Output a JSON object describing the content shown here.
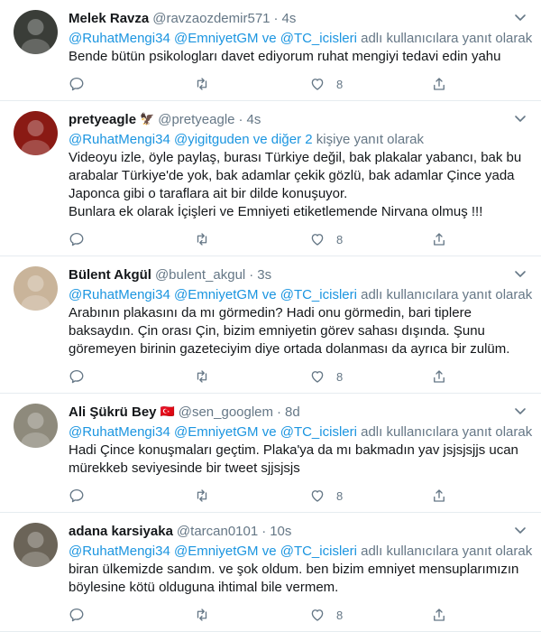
{
  "tweets": [
    {
      "name": "Melek Ravza",
      "badge": "",
      "handle": "@ravzaozdemir571",
      "dot": "·",
      "time": "4s",
      "reply_prefix": "",
      "reply_mentions": "@RuhatMengi34 @EmniyetGM ve @TC_icisleri",
      "reply_suffix": " adlı kullanıcılara yanıt olarak",
      "lines": [
        "Bende bütün psikologları davet ediyorum ruhat mengiyi tedavi edin yahu"
      ],
      "likes": "8",
      "avatar_color": "#3a3d38"
    },
    {
      "name": "pretyeagle",
      "badge": "🦅",
      "handle": "@pretyeagle",
      "dot": "·",
      "time": "4s",
      "reply_mentions": "@RuhatMengi34 @yigitguden ve diğer 2",
      "reply_suffix": " kişiye yanıt olarak",
      "lines": [
        "Videoyu izle, öyle paylaş, burası Türkiye değil, bak plakalar yabancı, bak bu",
        "arabalar Türkiye'de yok, bak adamlar çekik gözlü, bak adamlar Çince yada",
        "Japonca gibi o taraflara ait bir dilde konuşuyor.",
        "Bunlara ek olarak İçişleri ve Emniyeti etiketlemende Nirvana olmuş !!!"
      ],
      "likes": "8",
      "avatar_color": "#8a1a14"
    },
    {
      "name": "Bülent Akgül",
      "badge": "",
      "handle": "@bulent_akgul",
      "dot": "·",
      "time": "3s",
      "reply_mentions": "@RuhatMengi34 @EmniyetGM ve @TC_icisleri",
      "reply_suffix": " adlı kullanıcılara yanıt olarak",
      "lines": [
        "Arabının plakasını da mı görmedin? Hadi onu görmedin, bari tiplere",
        "baksaydın. Çin orası Çin, bizim emniyetin görev sahası dışında. Şunu",
        "göremeyen birinin gazeteciyim diye ortada dolanması da ayrıca bir zulüm."
      ],
      "likes": "8",
      "avatar_color": "#c9b49a"
    },
    {
      "name": "Ali Şükrü Bey",
      "badge": "🇹🇷",
      "handle": "@sen_googlem",
      "dot": "·",
      "time": "8d",
      "reply_mentions": "@RuhatMengi34 @EmniyetGM ve @TC_icisleri",
      "reply_suffix": " adlı kullanıcılara yanıt olarak",
      "lines": [
        "Hadi Çince konuşmaları geçtim. Plaka'ya da mı bakmadın yav jsjsjsjjs ucan",
        "mürekkeb seviyesinde bir tweet sjjsjsjs"
      ],
      "likes": "8",
      "avatar_color": "#8e8a7c"
    },
    {
      "name": "adana karsiyaka",
      "badge": "",
      "handle": "@tarcan0101",
      "dot": "·",
      "time": "10s",
      "reply_mentions": "@RuhatMengi34 @EmniyetGM ve @TC_icisleri",
      "reply_suffix": " adlı kullanıcılara yanıt olarak",
      "lines": [
        "biran ülkemizde sandım. ve şok oldum. ben bizim emniyet mensuplarımızın",
        "böylesine kötü olduguna ihtimal bile vermem."
      ],
      "likes": "8",
      "avatar_color": "#6b6458"
    }
  ]
}
